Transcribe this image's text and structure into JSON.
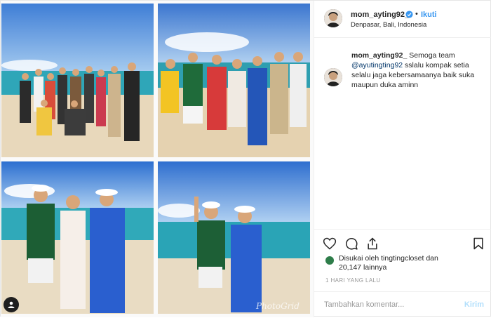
{
  "post": {
    "username": "mom_ayting92_",
    "follow_label": "Ikuti",
    "separator": "•",
    "location": "Denpasar, Bali, Indonesia",
    "caption_user": "mom_ayting92_",
    "caption_before_mention": " Semoga team ",
    "mention": "@ayutingting92",
    "caption_after_mention": " sslalu kompak setia selalu jaga kebersamaanya baik suka maupun duka aminn",
    "likes_text_line1": "Disukai oleh tingtingcloset dan",
    "likes_text_line2": "20,147 lainnya",
    "time_ago": "1 HARI YANG LALU",
    "add_comment_placeholder": "Tambahkan komentar...",
    "post_button": "Kirim",
    "watermark": "PhotoGrid"
  },
  "icons": {
    "verified": "verified-badge-icon",
    "like": "heart-icon",
    "comment": "comment-bubble-icon",
    "share": "share-icon",
    "save": "bookmark-icon",
    "tag": "user-tag-icon"
  },
  "colors": {
    "link": "#3897f0",
    "mention": "#003569",
    "muted": "#999999",
    "border": "#efefef",
    "post_disabled": "#b2dffc"
  }
}
